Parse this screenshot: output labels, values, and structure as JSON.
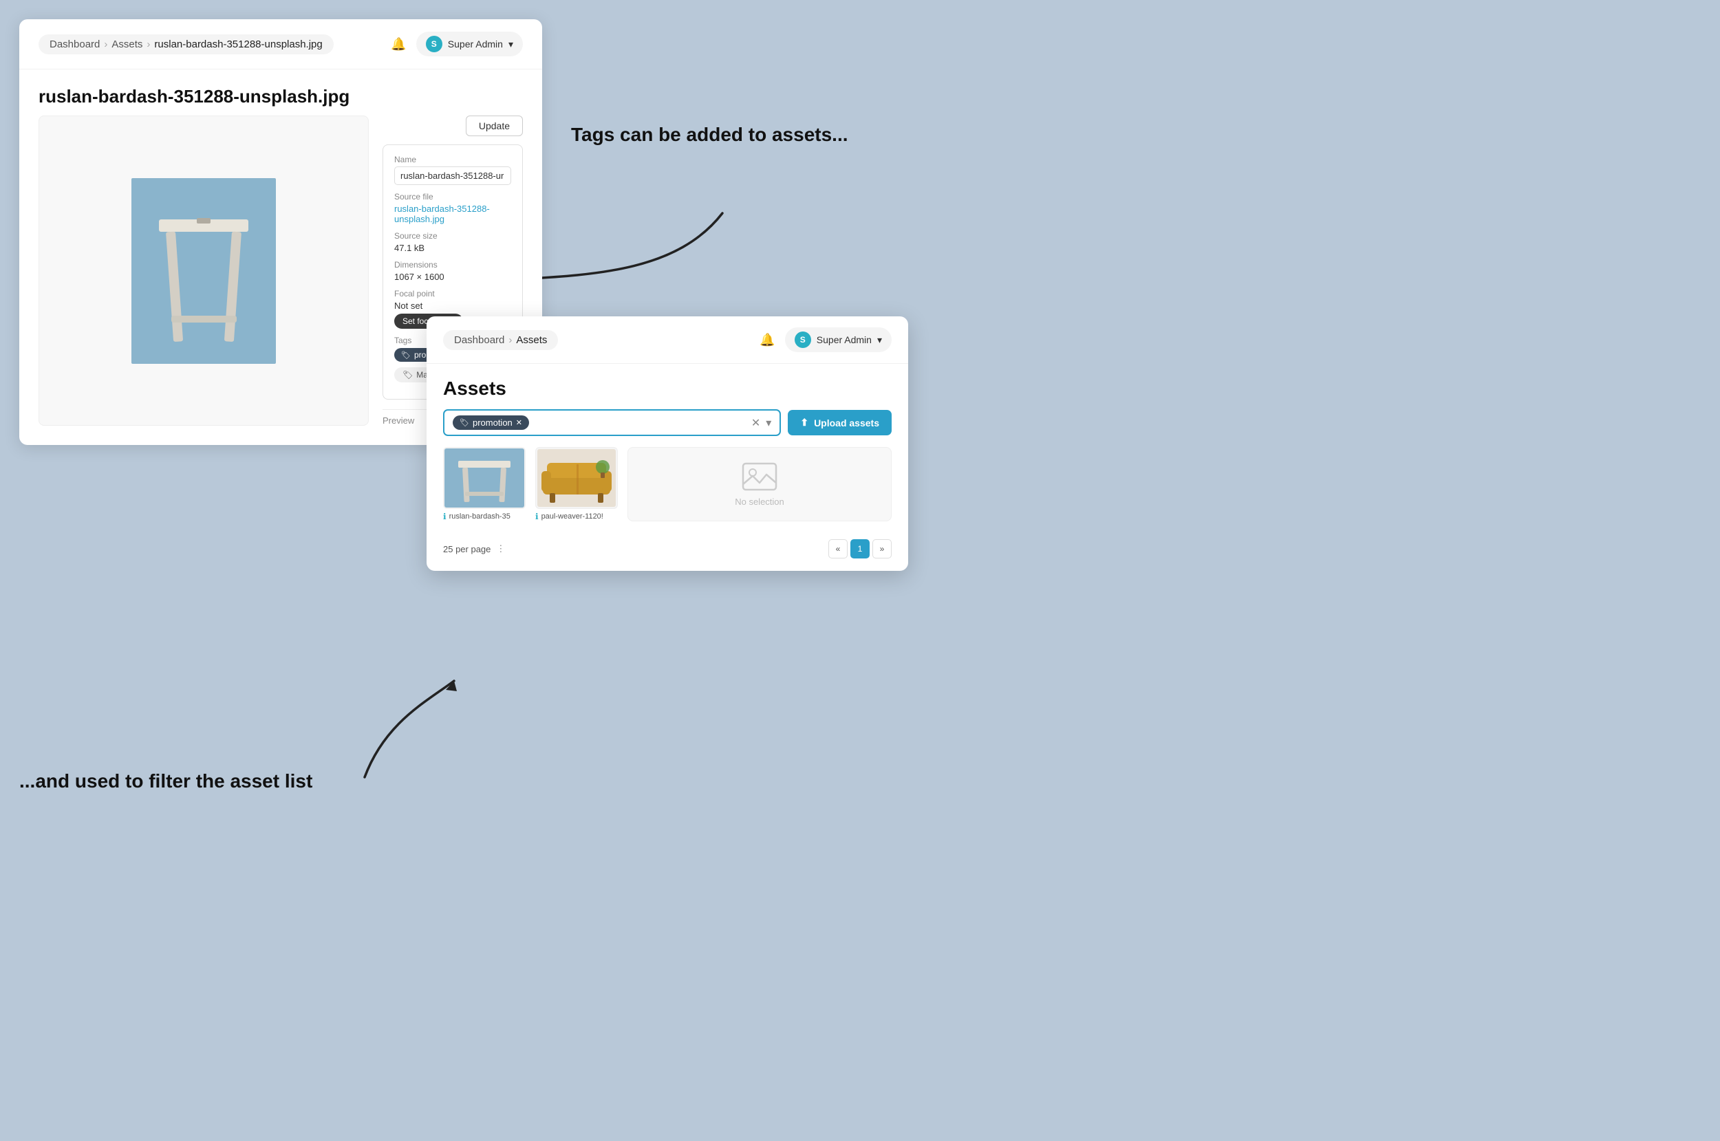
{
  "card1": {
    "breadcrumb": {
      "dashboard": "Dashboard",
      "assets": "Assets",
      "file": "ruslan-bardash-351288-unsplash.jpg"
    },
    "user": "Super Admin",
    "title": "ruslan-bardash-351288-unsplash.jpg",
    "update_btn": "Update",
    "info": {
      "name_label": "Name",
      "name_value": "ruslan-bardash-351288-ur",
      "source_file_label": "Source file",
      "source_file_link": "ruslan-bardash-351288-unsplash.jpg",
      "source_size_label": "Source size",
      "source_size_value": "47.1 kB",
      "dimensions_label": "Dimensions",
      "dimensions_value": "1067 × 1600",
      "focal_label": "Focal point",
      "focal_value": "Not set",
      "focal_btn": "Set focal point",
      "tags_label": "Tags",
      "tag_name": "promotion",
      "manage_tags_btn": "Manage tags"
    },
    "preview_tab": "Preview"
  },
  "card2": {
    "breadcrumb": {
      "dashboard": "Dashboard",
      "assets": "Assets"
    },
    "user": "Super Admin",
    "title": "Assets",
    "search": {
      "tag": "promotion",
      "placeholder": "",
      "upload_btn": "Upload assets"
    },
    "assets": [
      {
        "name": "ruslan-bardash-35"
      },
      {
        "name": "paul-weaver-1120!"
      }
    ],
    "no_selection": "No selection",
    "pagination": {
      "per_page": "25 per page",
      "page": "1"
    }
  },
  "annotations": {
    "tags": "Tags can be added to assets...",
    "filter": "...and used to filter the asset list"
  },
  "colors": {
    "accent": "#2a9fc9",
    "tag_bg": "#3a4a5c",
    "bg": "#b8c8d8"
  }
}
